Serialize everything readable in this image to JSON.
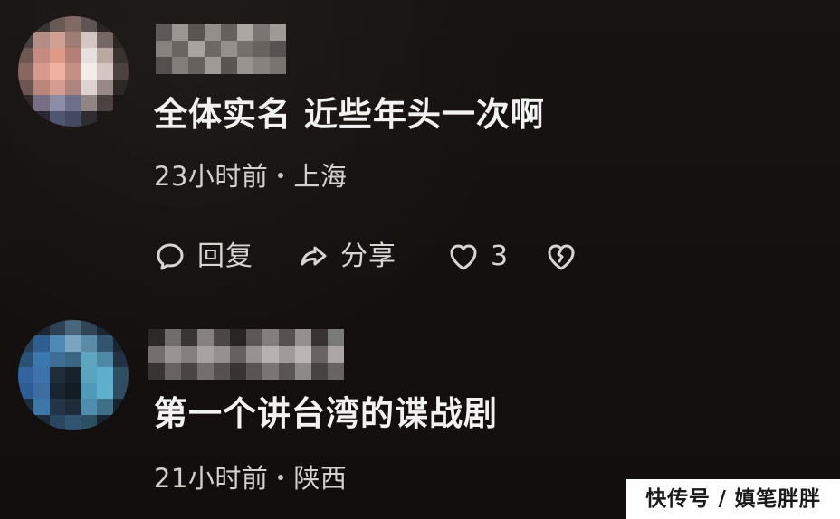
{
  "comments": [
    {
      "text": "全体实名 近些年头一次啊",
      "time": "23小时前",
      "location": "上海",
      "actions": {
        "reply": "回复",
        "share": "分享",
        "likes": "3"
      },
      "icons": {
        "reply": "speech-bubble-icon",
        "share": "share-arrow-icon",
        "like": "heart-icon",
        "dislike": "broken-heart-icon"
      }
    },
    {
      "text": "第一个讲台湾的谍战剧",
      "time": "21小时前",
      "location": "陕西"
    }
  ],
  "watermark": "快传号 / 嫃笔胖胖",
  "colors": {
    "background": "#151110",
    "primary_text": "#f2f2f2",
    "secondary_text": "#d4d0cc",
    "watermark_bg": "#ffffff",
    "watermark_text": "#1a1a1a"
  }
}
